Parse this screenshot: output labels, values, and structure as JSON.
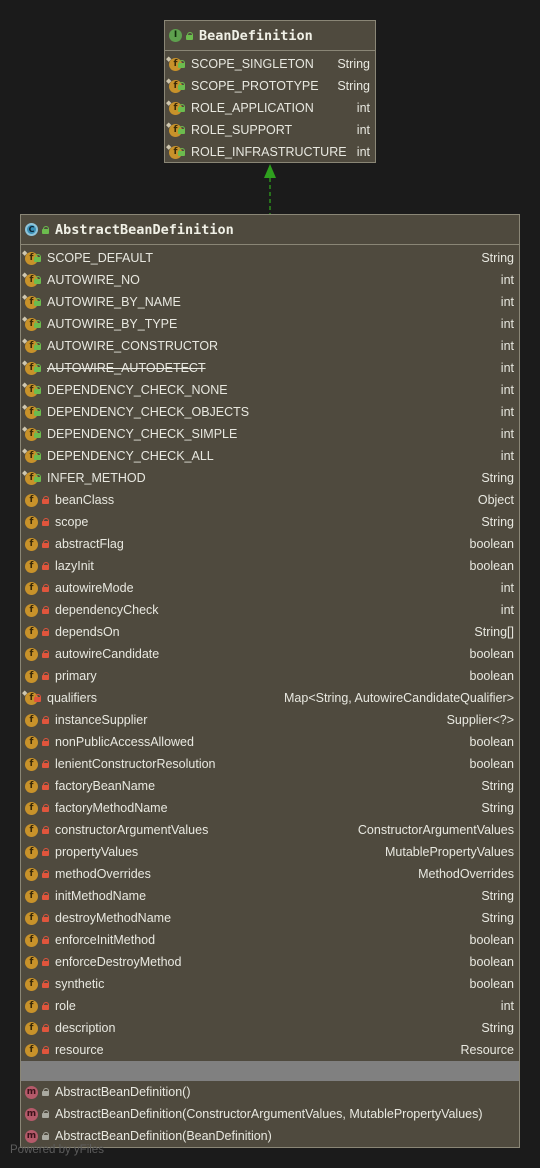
{
  "interface": {
    "name": "BeanDefinition",
    "kind_icon": "interface-icon",
    "fields": [
      {
        "name": "SCOPE_SINGLETON",
        "type": "String",
        "access": "public"
      },
      {
        "name": "SCOPE_PROTOTYPE",
        "type": "String",
        "access": "public"
      },
      {
        "name": "ROLE_APPLICATION",
        "type": "int",
        "access": "public"
      },
      {
        "name": "ROLE_SUPPORT",
        "type": "int",
        "access": "public"
      },
      {
        "name": "ROLE_INFRASTRUCTURE",
        "type": "int",
        "access": "public"
      }
    ]
  },
  "class": {
    "name": "AbstractBeanDefinition",
    "kind_icon": "abstract-class-icon",
    "fields": [
      {
        "name": "SCOPE_DEFAULT",
        "type": "String",
        "access": "public",
        "static": true
      },
      {
        "name": "AUTOWIRE_NO",
        "type": "int",
        "access": "public",
        "static": true
      },
      {
        "name": "AUTOWIRE_BY_NAME",
        "type": "int",
        "access": "public",
        "static": true
      },
      {
        "name": "AUTOWIRE_BY_TYPE",
        "type": "int",
        "access": "public",
        "static": true
      },
      {
        "name": "AUTOWIRE_CONSTRUCTOR",
        "type": "int",
        "access": "public",
        "static": true
      },
      {
        "name": "AUTOWIRE_AUTODETECT",
        "type": "int",
        "access": "public",
        "static": true,
        "deprecated": true
      },
      {
        "name": "DEPENDENCY_CHECK_NONE",
        "type": "int",
        "access": "public",
        "static": true
      },
      {
        "name": "DEPENDENCY_CHECK_OBJECTS",
        "type": "int",
        "access": "public",
        "static": true
      },
      {
        "name": "DEPENDENCY_CHECK_SIMPLE",
        "type": "int",
        "access": "public",
        "static": true
      },
      {
        "name": "DEPENDENCY_CHECK_ALL",
        "type": "int",
        "access": "public",
        "static": true
      },
      {
        "name": "INFER_METHOD",
        "type": "String",
        "access": "public",
        "static": true
      },
      {
        "name": "beanClass",
        "type": "Object",
        "access": "private"
      },
      {
        "name": "scope",
        "type": "String",
        "access": "private"
      },
      {
        "name": "abstractFlag",
        "type": "boolean",
        "access": "private"
      },
      {
        "name": "lazyInit",
        "type": "boolean",
        "access": "private"
      },
      {
        "name": "autowireMode",
        "type": "int",
        "access": "private"
      },
      {
        "name": "dependencyCheck",
        "type": "int",
        "access": "private"
      },
      {
        "name": "dependsOn",
        "type": "String[]",
        "access": "private"
      },
      {
        "name": "autowireCandidate",
        "type": "boolean",
        "access": "private"
      },
      {
        "name": "primary",
        "type": "boolean",
        "access": "private"
      },
      {
        "name": "qualifiers",
        "type": "Map<String, AutowireCandidateQualifier>",
        "access": "private",
        "static": true
      },
      {
        "name": "instanceSupplier",
        "type": "Supplier<?>",
        "access": "private"
      },
      {
        "name": "nonPublicAccessAllowed",
        "type": "boolean",
        "access": "private"
      },
      {
        "name": "lenientConstructorResolution",
        "type": "boolean",
        "access": "private"
      },
      {
        "name": "factoryBeanName",
        "type": "String",
        "access": "private"
      },
      {
        "name": "factoryMethodName",
        "type": "String",
        "access": "private"
      },
      {
        "name": "constructorArgumentValues",
        "type": "ConstructorArgumentValues",
        "access": "private"
      },
      {
        "name": "propertyValues",
        "type": "MutablePropertyValues",
        "access": "private"
      },
      {
        "name": "methodOverrides",
        "type": "MethodOverrides",
        "access": "private"
      },
      {
        "name": "initMethodName",
        "type": "String",
        "access": "private"
      },
      {
        "name": "destroyMethodName",
        "type": "String",
        "access": "private"
      },
      {
        "name": "enforceInitMethod",
        "type": "boolean",
        "access": "private"
      },
      {
        "name": "enforceDestroyMethod",
        "type": "boolean",
        "access": "private"
      },
      {
        "name": "synthetic",
        "type": "boolean",
        "access": "private"
      },
      {
        "name": "role",
        "type": "int",
        "access": "private"
      },
      {
        "name": "description",
        "type": "String",
        "access": "private"
      },
      {
        "name": "resource",
        "type": "Resource",
        "access": "private"
      }
    ],
    "constructors": [
      {
        "signature": "AbstractBeanDefinition()",
        "access": "protected"
      },
      {
        "signature": "AbstractBeanDefinition(ConstructorArgumentValues, MutablePropertyValues)",
        "access": "protected"
      },
      {
        "signature": "AbstractBeanDefinition(BeanDefinition)",
        "access": "protected"
      }
    ]
  },
  "edge": {
    "from": "AbstractBeanDefinition",
    "to": "BeanDefinition",
    "color": "#2fa01e"
  },
  "footer": "Powered by yFiles",
  "colors": {
    "background": "#1b1b1b",
    "node_fill": "#4f4a3e",
    "field_icon": "#c8922a",
    "method_icon": "#b55a6a",
    "public_lock": "#6cbc4e",
    "private_lock": "#e0553c"
  }
}
